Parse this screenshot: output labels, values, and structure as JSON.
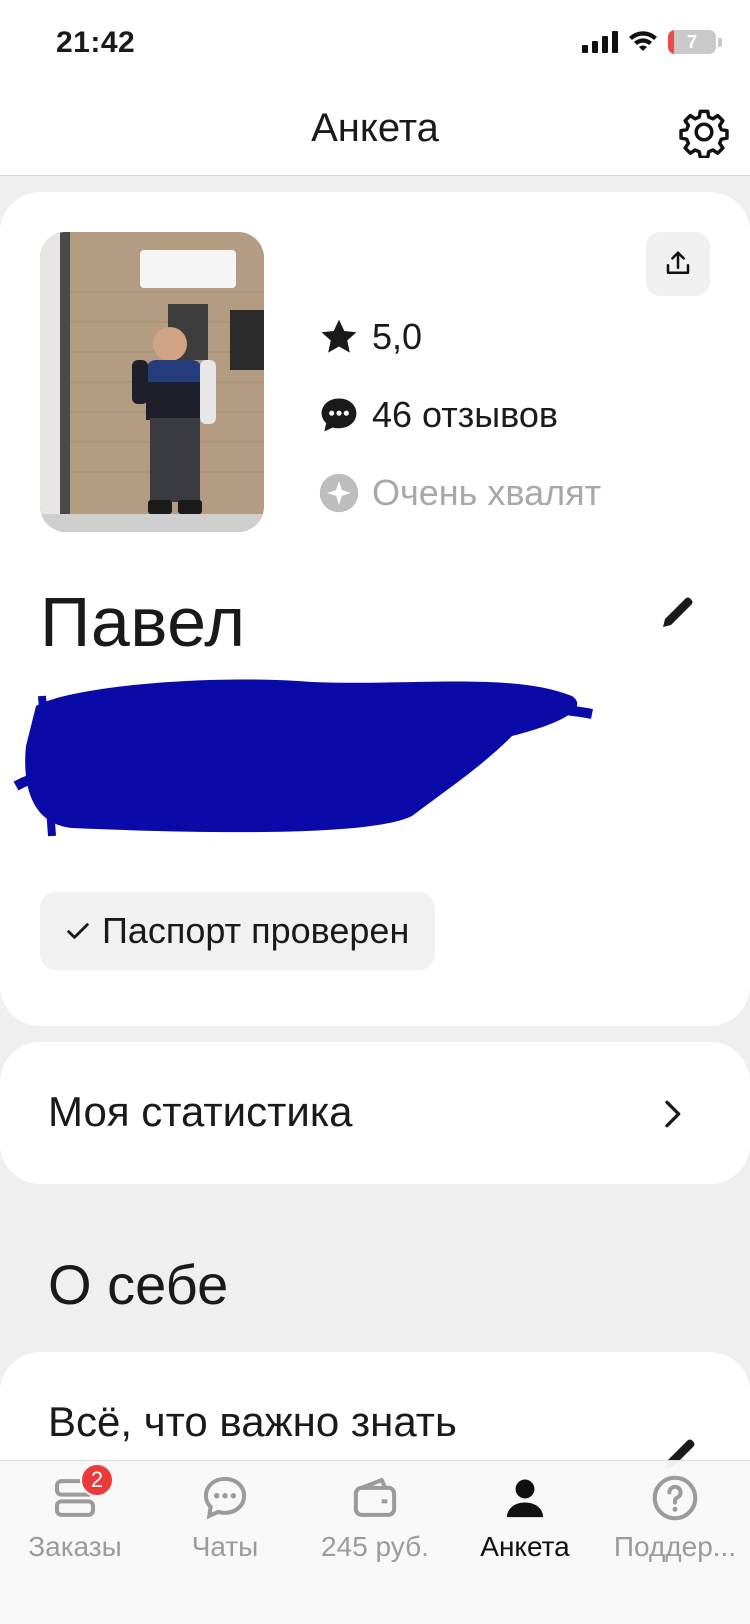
{
  "status_bar": {
    "time": "21:42",
    "battery": "7",
    "battery_level": 0.07
  },
  "header": {
    "title": "Анкета"
  },
  "profile": {
    "rating": "5,0",
    "reviews": "46 отзывов",
    "praise": "Очень хвалят",
    "name": "Павел",
    "passport_badge": "Паспорт проверен"
  },
  "statistics": {
    "label": "Моя статистика"
  },
  "about": {
    "title": "О себе",
    "card_title": "Всё, что важно знать"
  },
  "tabbar": {
    "tabs": [
      {
        "label": "Заказы",
        "icon": "orders-icon",
        "badge": "2"
      },
      {
        "label": "Чаты",
        "icon": "chat-icon"
      },
      {
        "label": "245 руб.",
        "icon": "wallet-icon"
      },
      {
        "label": "Анкета",
        "icon": "profile-icon",
        "active": true
      },
      {
        "label": "Поддер...",
        "icon": "help-icon"
      }
    ]
  },
  "colors": {
    "accent": "#1a1a1a",
    "badge": "#ea3b3b",
    "redaction": "#0a0aa8",
    "muted": "#a8a8a8"
  }
}
